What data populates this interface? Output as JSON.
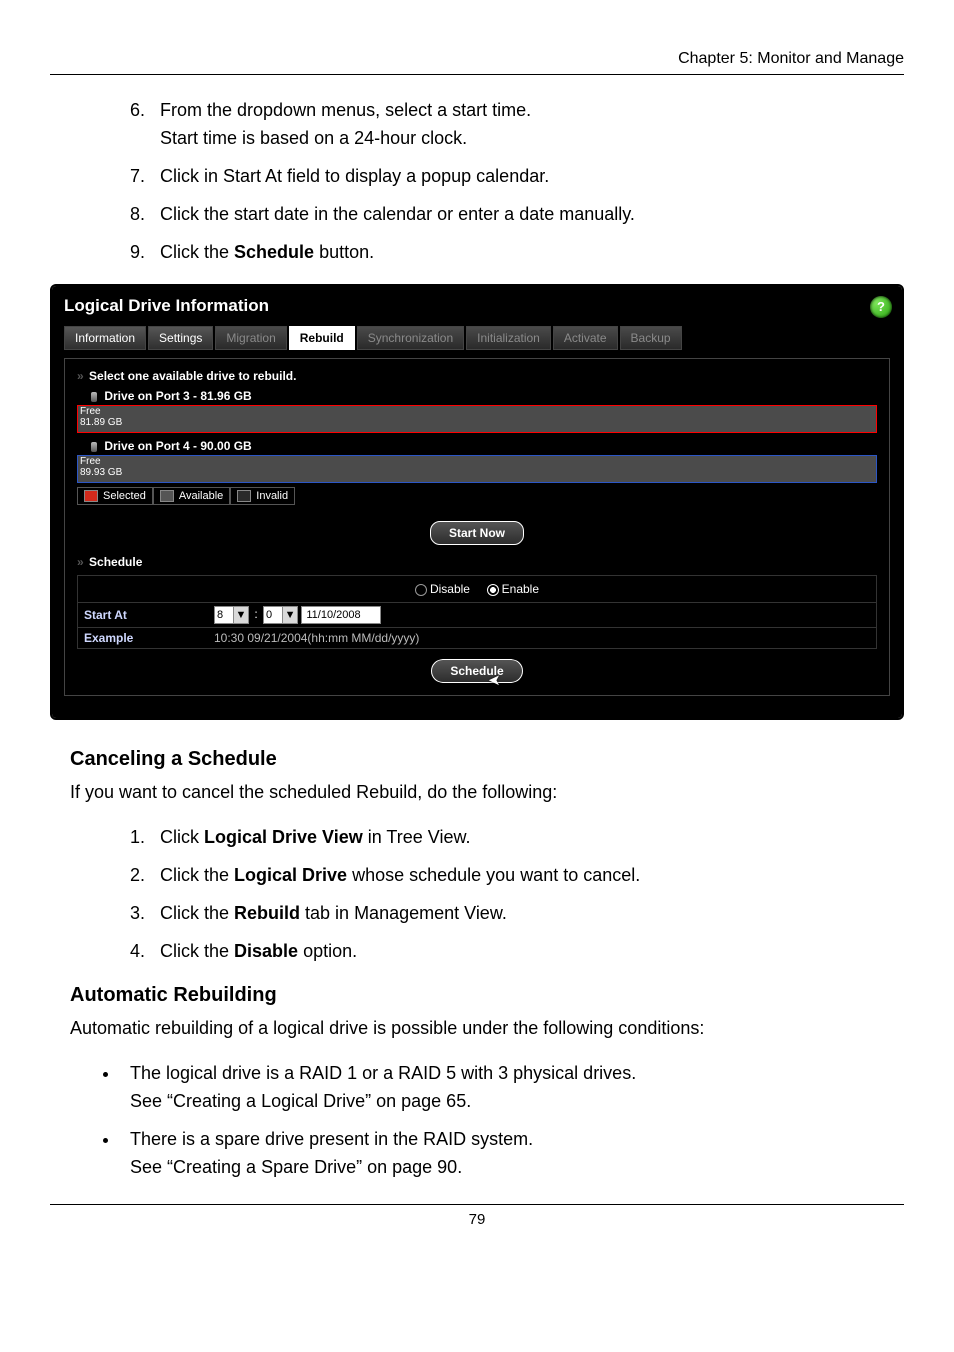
{
  "header": {
    "chapter": "Chapter 5: Monitor and Manage"
  },
  "steps_a": [
    {
      "n": "6",
      "text_a": "From the dropdown menus, select a start time.",
      "text_b": "Start time is based on a 24-hour clock."
    },
    {
      "n": "7",
      "text_a": "Click in Start At field to display a popup calendar."
    },
    {
      "n": "8",
      "text_a": "Click the start date in the calendar or enter a date manually."
    },
    {
      "n": "9",
      "text_a": "Click the ",
      "bold": "Schedule",
      "text_b": " button."
    }
  ],
  "shot": {
    "title": "Logical Drive Information",
    "help": "?",
    "tabs": {
      "information": "Information",
      "settings": "Settings",
      "migration": "Migration",
      "rebuild": "Rebuild",
      "sync": "Synchronization",
      "init": "Initialization",
      "activate": "Activate",
      "backup": "Backup"
    },
    "select_label": "Select one available drive to rebuild.",
    "drive3": {
      "label": "Drive on Port 3 - 81.96 GB",
      "free_label": "Free",
      "free_val": "81.89 GB"
    },
    "drive4": {
      "label": "Drive on Port 4 - 90.00 GB",
      "free_label": "Free",
      "free_val": "89.93 GB"
    },
    "legend": {
      "selected": "Selected",
      "available": "Available",
      "invalid": "Invalid"
    },
    "start_now": "Start Now",
    "schedule_label": "Schedule",
    "radio": {
      "disable": "Disable",
      "enable": "Enable"
    },
    "form": {
      "start_at": "Start At",
      "hour": "8",
      "minute": "0",
      "date": "11/10/2008",
      "example_label": "Example",
      "example_value": "10:30 09/21/2004(hh:mm MM/dd/yyyy)"
    },
    "schedule_btn": "Schedule"
  },
  "cancel": {
    "heading": "Canceling a Schedule",
    "intro": "If you want to cancel the scheduled Rebuild, do the following:",
    "steps": [
      {
        "t1": "Click ",
        "b": "Logical Drive View",
        "t2": " in Tree View."
      },
      {
        "t1": "Click the ",
        "b": "Logical Drive",
        "t2": " whose schedule you want to cancel."
      },
      {
        "t1": "Click the ",
        "b": "Rebuild",
        "t2": " tab in Management View."
      },
      {
        "t1": "Click the ",
        "b": "Disable",
        "t2": " option."
      }
    ]
  },
  "auto": {
    "heading": "Automatic Rebuilding",
    "intro": "Automatic rebuilding of a logical drive is possible under the following conditions:",
    "bullets": [
      {
        "line1": "The logical drive is a RAID 1 or a RAID 5 with 3 physical drives.",
        "line2": "See “Creating a Logical Drive” on page 65."
      },
      {
        "line1": "There is a spare drive present in the RAID system.",
        "line2": "See “Creating a Spare Drive” on page 90."
      }
    ]
  },
  "page_number": "79"
}
